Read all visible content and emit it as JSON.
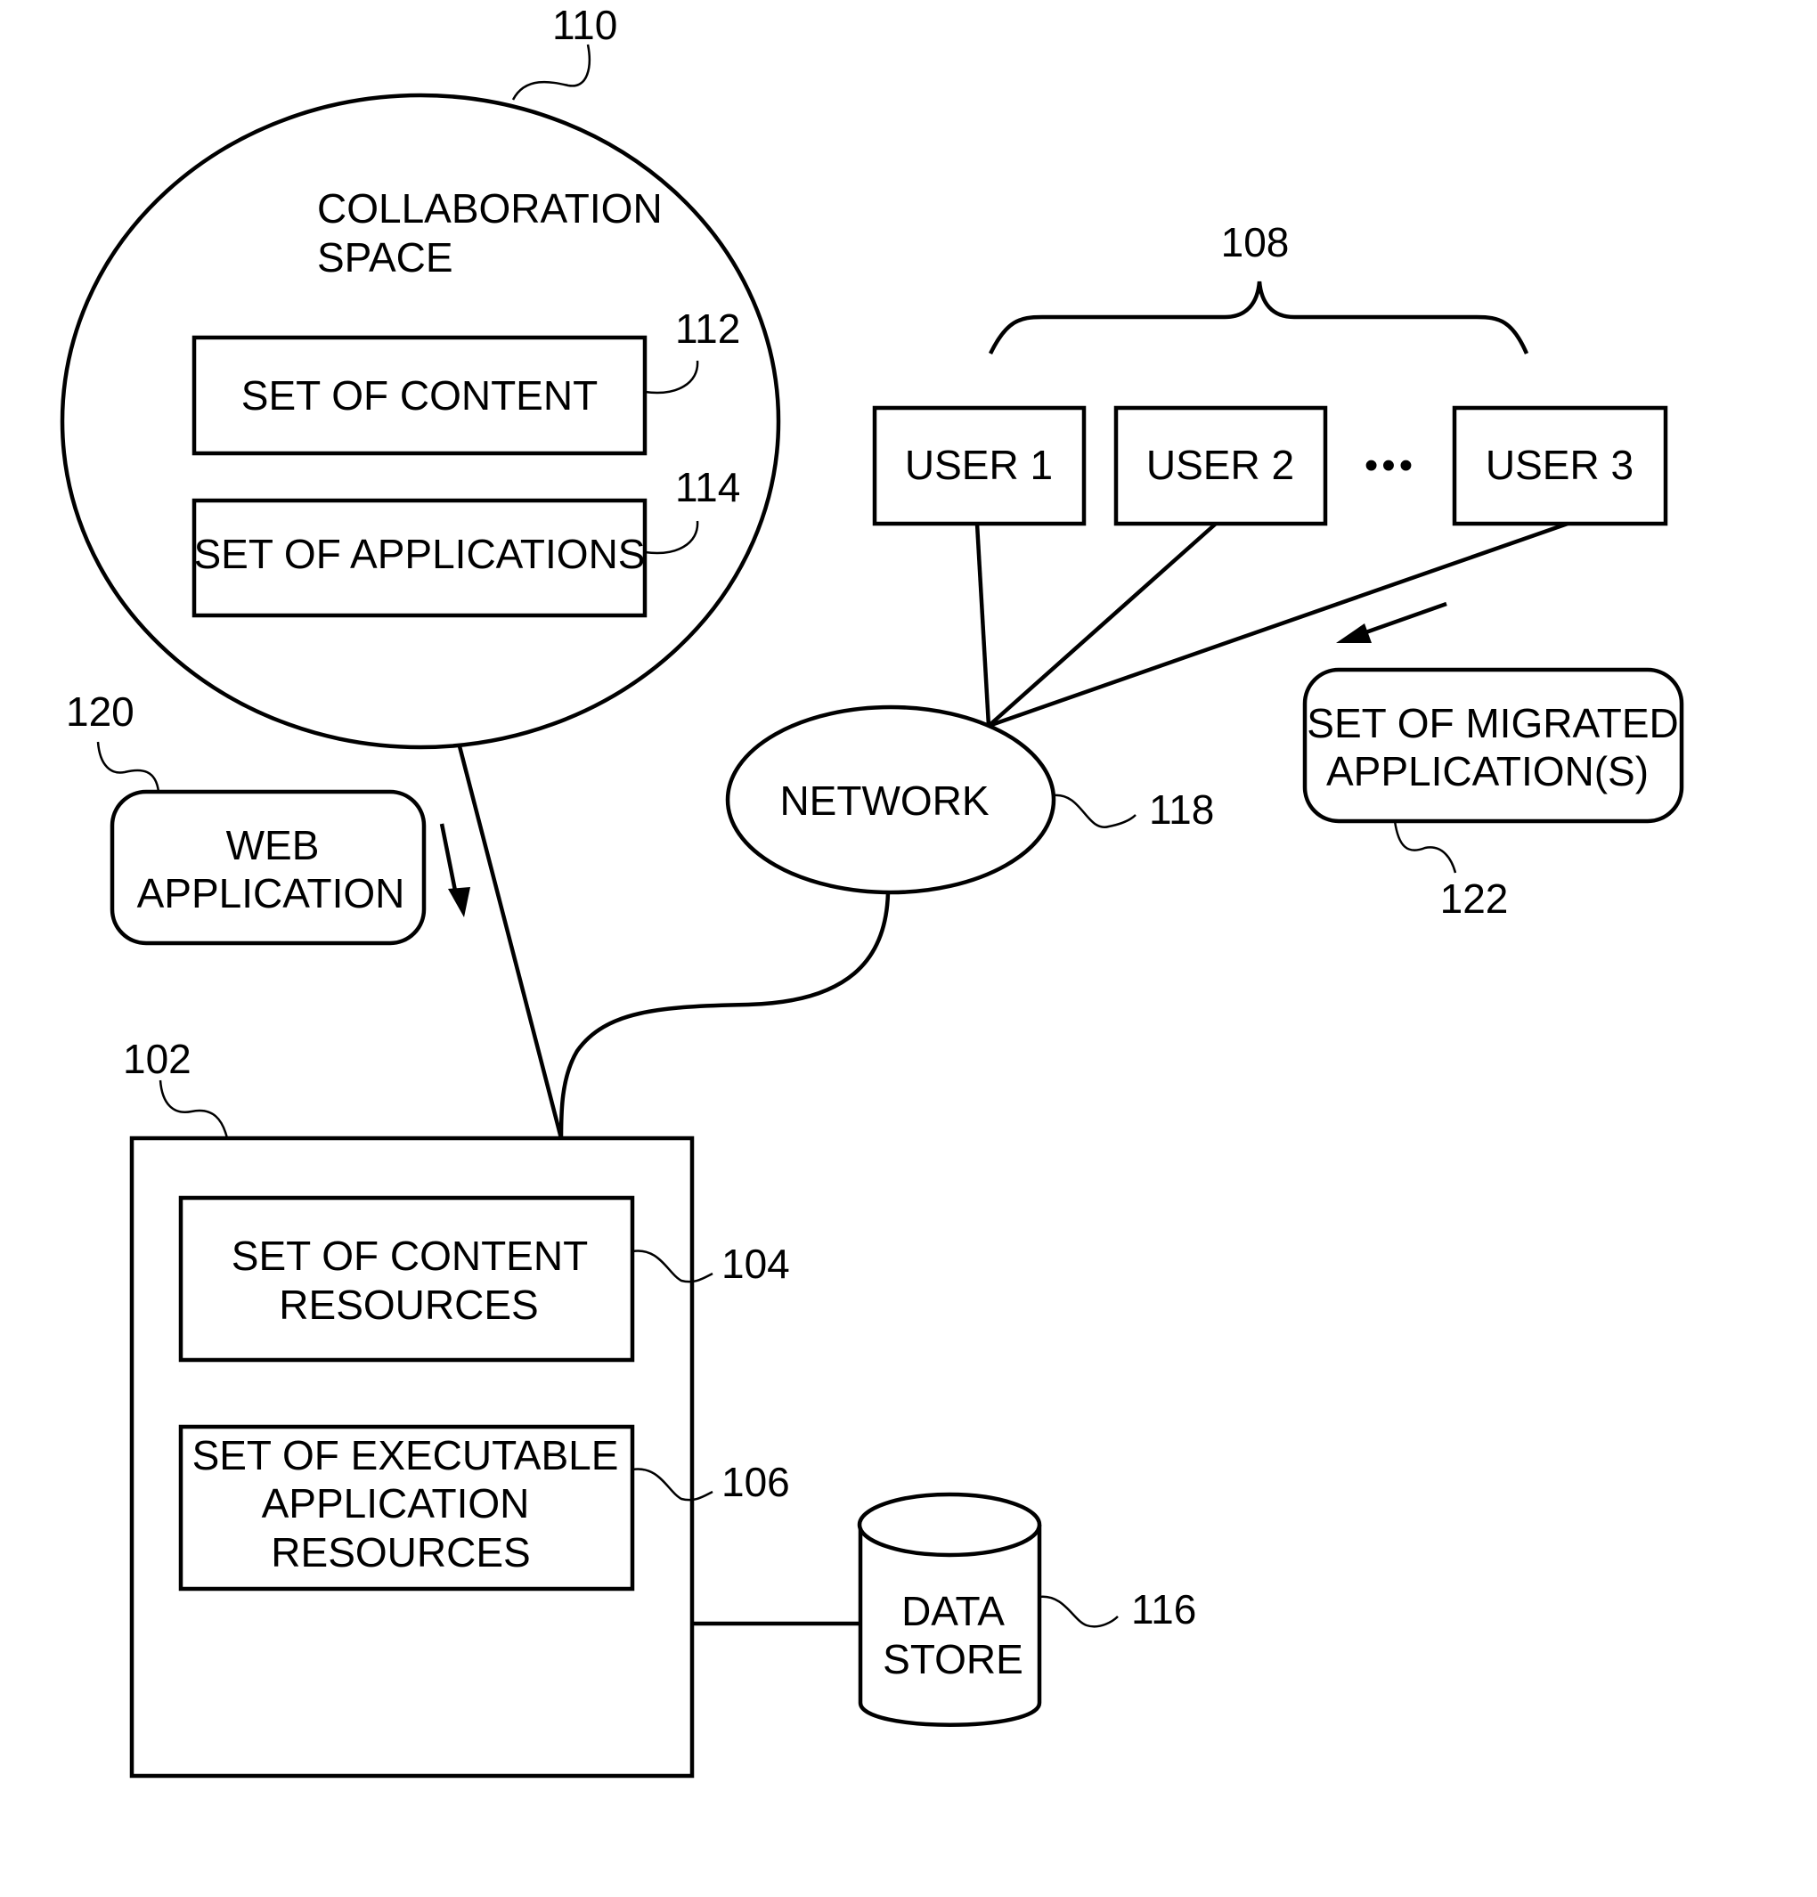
{
  "figure": {
    "nodes": {
      "collaboration_space": {
        "ref": "110",
        "title_lines": [
          "COLLABORATION",
          "SPACE"
        ]
      },
      "set_of_content": {
        "ref": "112",
        "lines": [
          "SET OF CONTENT"
        ]
      },
      "set_of_applications": {
        "ref": "114",
        "lines": [
          "SET OF APPLICATIONS"
        ]
      },
      "users_group": {
        "ref": "108"
      },
      "user1": {
        "lines": [
          "USER 1"
        ]
      },
      "user2": {
        "lines": [
          "USER 2"
        ]
      },
      "user3": {
        "lines": [
          "USER 3"
        ]
      },
      "ellipsis": "•••",
      "network": {
        "ref": "118",
        "lines": [
          "NETWORK"
        ]
      },
      "migrated_apps": {
        "ref": "122",
        "lines": [
          "SET OF MIGRATED",
          "APPLICATION(S)"
        ]
      },
      "web_application": {
        "ref": "120",
        "lines": [
          "WEB",
          "APPLICATION"
        ]
      },
      "server": {
        "ref": "102"
      },
      "content_resources": {
        "ref": "104",
        "lines": [
          "SET OF CONTENT",
          "RESOURCES"
        ]
      },
      "executable_resources": {
        "ref": "106",
        "lines": [
          "SET OF EXECUTABLE",
          "APPLICATION",
          "RESOURCES"
        ]
      },
      "data_store": {
        "ref": "116",
        "lines": [
          "DATA",
          "STORE"
        ]
      }
    }
  }
}
